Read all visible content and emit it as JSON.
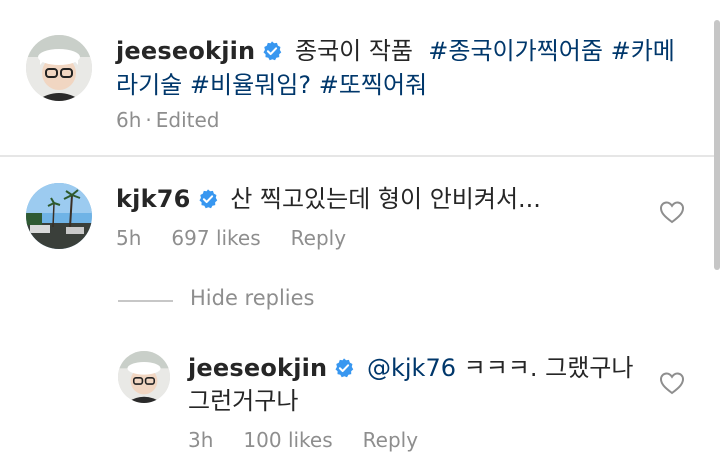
{
  "post": {
    "username": "jeeseokjin",
    "caption_text": "종국이 작품",
    "hashtags_line1": [
      "#종국이가찍어줌",
      "#카메"
    ],
    "caption_line2_prefix": "라기술",
    "hashtags_line2": [
      "#비율뭐임?",
      "#또찍어줘"
    ],
    "time": "6h",
    "edited": "Edited"
  },
  "comment": {
    "username": "kjk76",
    "text": "산 찍고있는데 형이 안비켜서...",
    "time": "5h",
    "likes": "697 likes",
    "reply_label": "Reply"
  },
  "hide_replies_label": "Hide replies",
  "reply": {
    "username": "jeeseokjin",
    "mention": "@kjk76",
    "text_line1": "ㅋㅋㅋ. 그랬구나",
    "text_line2": "그런거구나",
    "time": "3h",
    "likes": "100 likes",
    "reply_label": "Reply"
  },
  "colors": {
    "verified": "#3897f0",
    "hashtag": "#00376b",
    "meta": "#8e8e8e"
  },
  "icons": [
    "verified-badge-icon",
    "heart-icon"
  ]
}
